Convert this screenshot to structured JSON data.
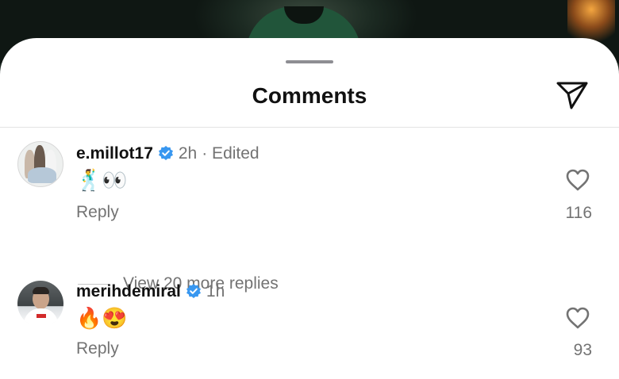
{
  "header": {
    "title": "Comments"
  },
  "comments": [
    {
      "username": "e.millot17",
      "verified": true,
      "time": "2h",
      "edited": "· Edited",
      "text": "🕺👀",
      "reply_label": "Reply",
      "likes": "116",
      "more_replies": "View 20 more replies"
    },
    {
      "username": "merihdemiral",
      "verified": true,
      "time": "1h",
      "text": "🔥😍",
      "reply_label": "Reply",
      "likes": "93"
    }
  ],
  "colors": {
    "verified_badge": "#3897f0",
    "secondary_text": "#737373",
    "sheet_bg": "#ffffff"
  },
  "icons": {
    "send": "send-icon",
    "like": "heart-icon",
    "verified": "verified-badge-icon"
  }
}
